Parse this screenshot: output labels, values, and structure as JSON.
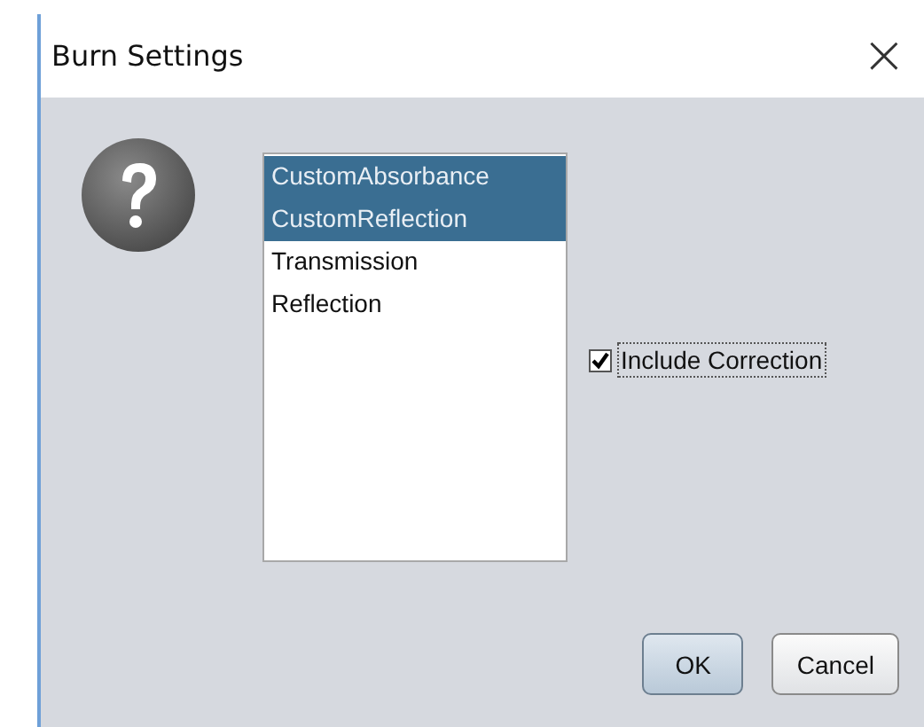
{
  "window": {
    "title": "Burn Settings",
    "close": "×"
  },
  "list": {
    "items": [
      {
        "label": "CustomAbsorbance",
        "selected": true
      },
      {
        "label": "CustomReflection",
        "selected": true
      },
      {
        "label": "Transmission",
        "selected": false
      },
      {
        "label": "Reflection",
        "selected": false
      }
    ]
  },
  "checkbox": {
    "label": "Include Correction",
    "checked": true,
    "focused": true
  },
  "buttons": [
    {
      "label": "OK",
      "kind": "default"
    },
    {
      "label": "Cancel",
      "kind": "normal"
    }
  ]
}
